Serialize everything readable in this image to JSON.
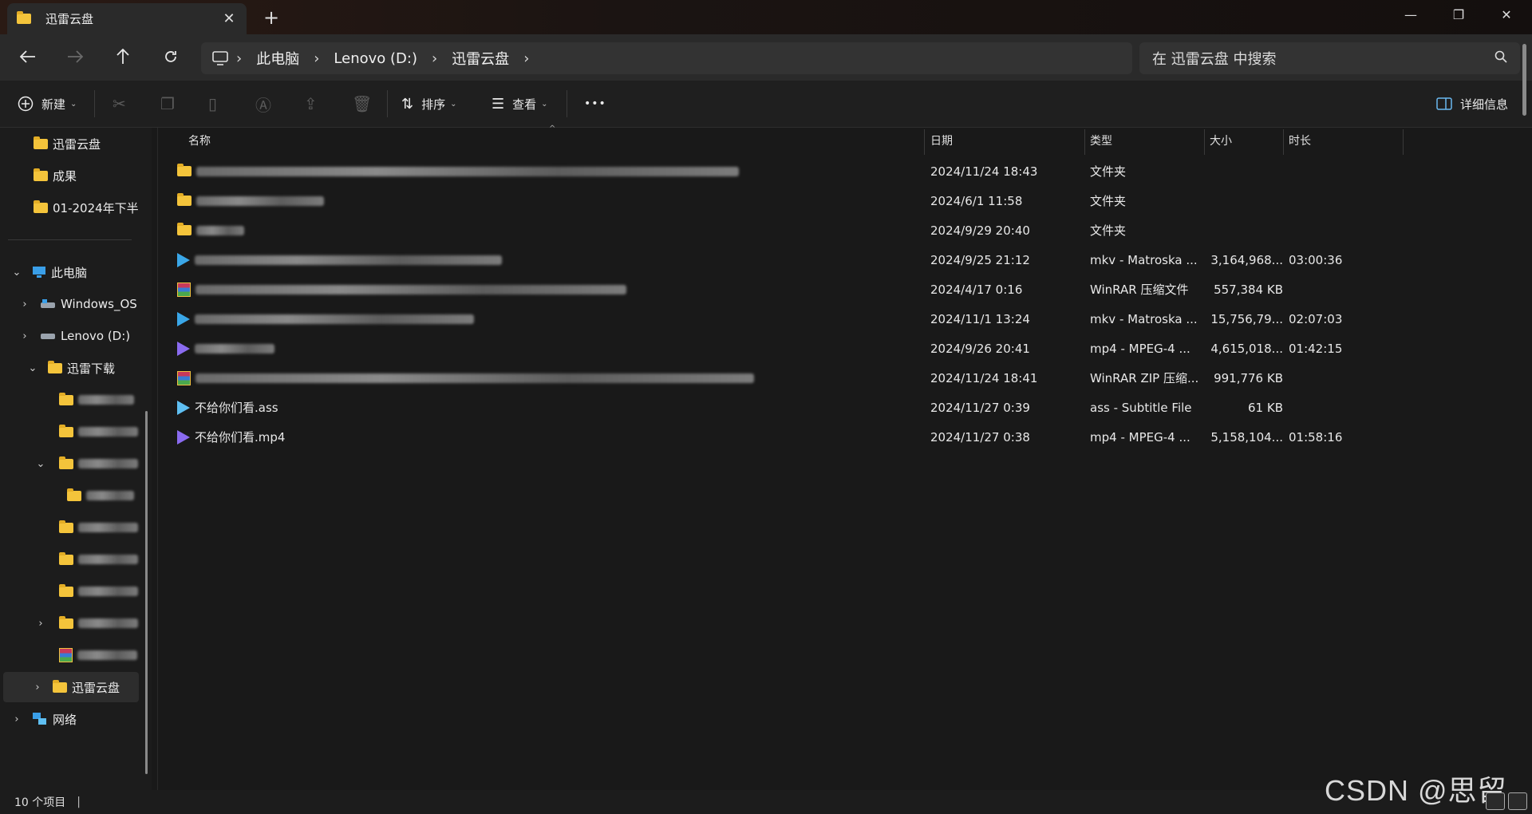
{
  "tab": {
    "title": "迅雷云盘",
    "close": "✕",
    "new": "+"
  },
  "window_controls": {
    "minimize": "—",
    "restore": "❐",
    "close": "✕"
  },
  "address": {
    "crumbs": [
      "此电脑",
      "Lenovo (D:)",
      "迅雷云盘"
    ],
    "search_placeholder": "在 迅雷云盘 中搜索"
  },
  "toolbar": {
    "new_label": "新建",
    "sort_label": "排序",
    "view_label": "查看",
    "more_label": "•••",
    "details_label": "详细信息"
  },
  "sidebar": {
    "quick": [
      "迅雷云盘",
      "成果",
      "01-2024年下半"
    ],
    "this_pc": "此电脑",
    "drive_c": "Windows_OS",
    "drive_d": "Lenovo (D:)",
    "xunlei_download": "迅雷下载",
    "xunlei_cloud": "迅雷云盘",
    "network": "网络"
  },
  "columns": {
    "name": "名称",
    "date": "日期",
    "type": "类型",
    "size": "大小",
    "duration": "时长"
  },
  "files": [
    {
      "icon": "folder",
      "name": "",
      "blur": 680,
      "date": "2024/11/24 18:43",
      "type": "文件夹",
      "size": "",
      "duration": ""
    },
    {
      "icon": "folder",
      "name": "",
      "blur": 160,
      "date": "2024/6/1 11:58",
      "type": "文件夹",
      "size": "",
      "duration": ""
    },
    {
      "icon": "folder",
      "name": "",
      "blur": 60,
      "date": "2024/9/29 20:40",
      "type": "文件夹",
      "size": "",
      "duration": ""
    },
    {
      "icon": "video",
      "name": "",
      "blur": 385,
      "date": "2024/9/25 21:12",
      "type": "mkv - Matroska ...",
      "size": "3,164,968...",
      "duration": "03:00:36"
    },
    {
      "icon": "winrar",
      "name": "",
      "blur": 540,
      "date": "2024/4/17 0:16",
      "type": "WinRAR 压缩文件",
      "size": "557,384 KB",
      "duration": ""
    },
    {
      "icon": "video",
      "name": "",
      "blur": 350,
      "date": "2024/11/1 13:24",
      "type": "mkv - Matroska ...",
      "size": "15,756,79...",
      "duration": "02:07:03"
    },
    {
      "icon": "video-purple",
      "name": "",
      "blur": 100,
      "date": "2024/9/26 20:41",
      "type": "mp4 - MPEG-4 ...",
      "size": "4,615,018...",
      "duration": "01:42:15"
    },
    {
      "icon": "winrar",
      "name": "",
      "blur": 700,
      "date": "2024/11/24 18:41",
      "type": "WinRAR ZIP 压缩...",
      "size": "991,776 KB",
      "duration": ""
    },
    {
      "icon": "ass",
      "name": "不给你们看.ass",
      "blur": 0,
      "date": "2024/11/27 0:39",
      "type": "ass - Subtitle File",
      "size": "61 KB",
      "duration": ""
    },
    {
      "icon": "video-purple",
      "name": "不给你们看.mp4",
      "blur": 0,
      "date": "2024/11/27 0:38",
      "type": "mp4 - MPEG-4 ...",
      "size": "5,158,104...",
      "duration": "01:58:16"
    }
  ],
  "status": {
    "count": "10 个项目",
    "pipe": "|"
  },
  "watermark": "CSDN @思留痕"
}
